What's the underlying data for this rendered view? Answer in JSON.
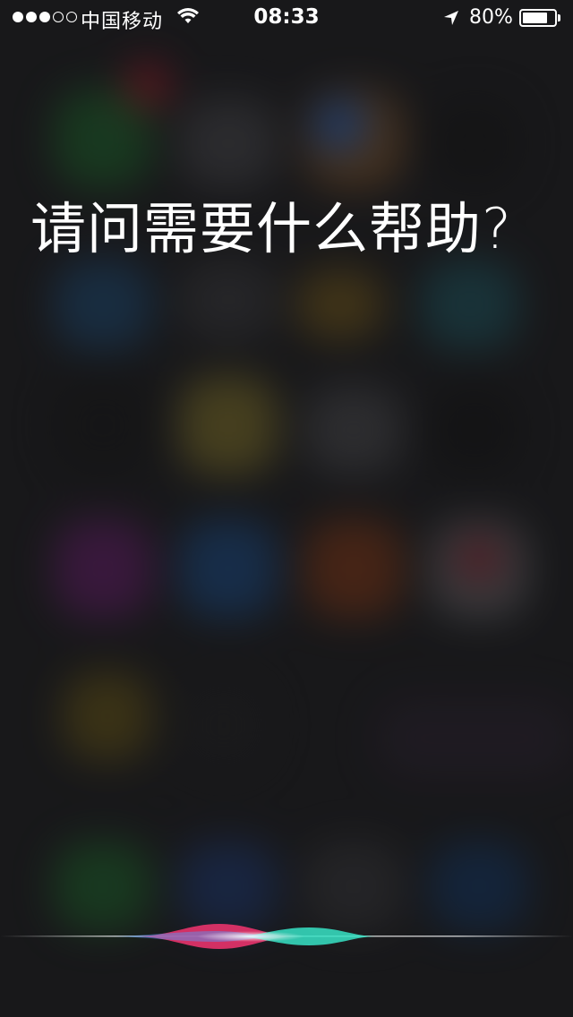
{
  "status_bar": {
    "signal_filled": 3,
    "signal_total": 5,
    "carrier": "中国移动",
    "wifi_icon": "wifi-icon",
    "time": "08:33",
    "location_icon": "location-arrow-icon",
    "battery_percent_text": "80%",
    "battery_level": 0.8
  },
  "siri": {
    "prompt": "请问需要什么帮助?",
    "waveform_colors": {
      "pink": "#e8336b",
      "cyan": "#37e3c6",
      "white": "#ffffff"
    }
  }
}
